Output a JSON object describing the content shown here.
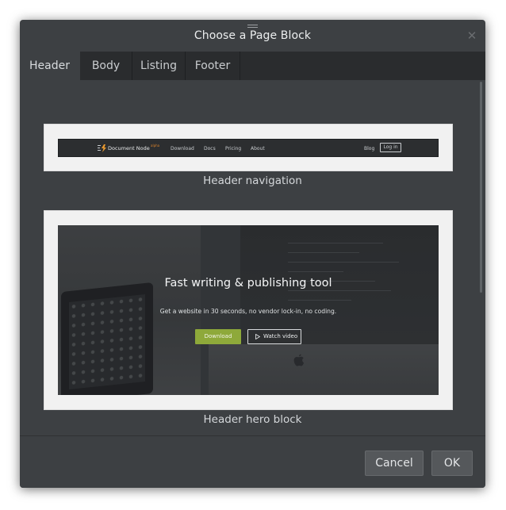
{
  "dialog": {
    "title": "Choose a Page Block",
    "close_icon": "close-icon"
  },
  "tabs": [
    {
      "label": "Header",
      "active": true
    },
    {
      "label": "Body",
      "active": false
    },
    {
      "label": "Listing",
      "active": false
    },
    {
      "label": "Footer",
      "active": false
    }
  ],
  "blocks": [
    {
      "caption": "Header navigation",
      "preview": {
        "brand": "Document Node",
        "brand_sup": "alpha",
        "links": [
          "Download",
          "Docs",
          "Pricing",
          "About"
        ],
        "right_link": "Blog",
        "login_label": "Log in"
      }
    },
    {
      "caption": "Header hero block",
      "preview": {
        "title": "Fast writing & publishing tool",
        "subtitle": "Get a website in 30 seconds, no vendor lock-in, no coding.",
        "primary_button": "Download",
        "secondary_button": "Watch video"
      }
    }
  ],
  "actions": {
    "cancel_label": "Cancel",
    "ok_label": "OK"
  },
  "colors": {
    "dialog_bg": "#3d4043",
    "tabbar_bg": "#2a2c2e",
    "accent_green": "#8ea93a",
    "logo_orange": "#e8982e"
  }
}
